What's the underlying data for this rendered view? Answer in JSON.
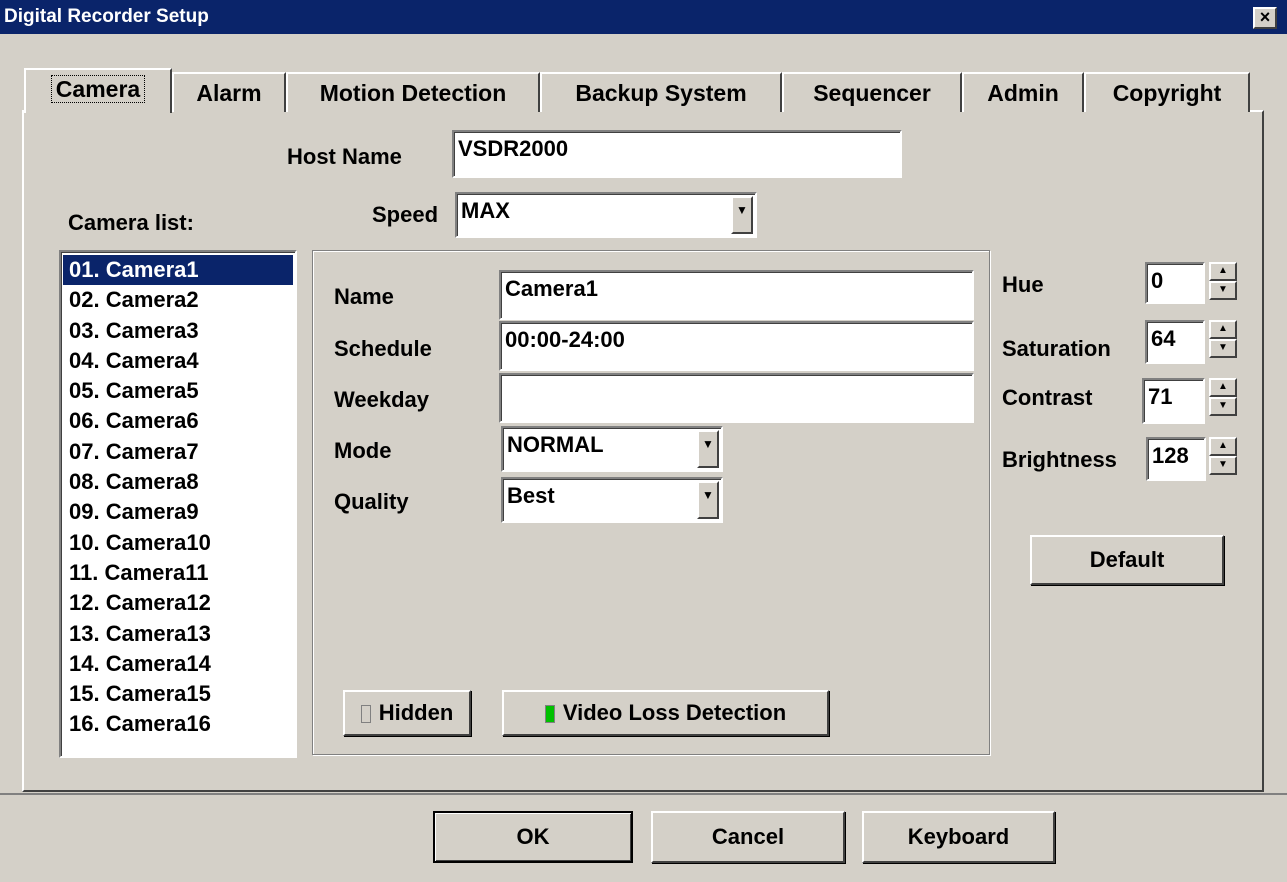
{
  "window": {
    "title": "Digital Recorder Setup",
    "close_label": "×"
  },
  "tabs": [
    {
      "label": "Camera",
      "active": true
    },
    {
      "label": "Alarm"
    },
    {
      "label": "Motion Detection"
    },
    {
      "label": "Backup System"
    },
    {
      "label": "Sequencer"
    },
    {
      "label": "Admin"
    },
    {
      "label": "Copyright"
    }
  ],
  "host": {
    "label": "Host Name",
    "value": "VSDR2000"
  },
  "speed": {
    "label": "Speed",
    "value": "MAX"
  },
  "camera_list": {
    "label": "Camera list:",
    "items": [
      "01. Camera1",
      "02. Camera2",
      "03. Camera3",
      "04. Camera4",
      "05. Camera5",
      "06. Camera6",
      "07. Camera7",
      "08. Camera8",
      "09. Camera9",
      "10. Camera10",
      "11. Camera11",
      "12. Camera12",
      "13. Camera13",
      "14. Camera14",
      "15. Camera15",
      "16. Camera16"
    ],
    "selected_index": 0
  },
  "details": {
    "name": {
      "label": "Name",
      "value": "Camera1"
    },
    "schedule": {
      "label": "Schedule",
      "value": "00:00-24:00"
    },
    "weekday": {
      "label": "Weekday",
      "value": ""
    },
    "mode": {
      "label": "Mode",
      "value": "NORMAL"
    },
    "quality": {
      "label": "Quality",
      "value": "Best"
    },
    "hidden_label": "Hidden",
    "hidden_on": false,
    "video_loss_label": "Video Loss Detection",
    "video_loss_on": true,
    "led_on_color": "#00c000",
    "led_off_color": "#d4d0c8"
  },
  "adjust": {
    "hue": {
      "label": "Hue",
      "value": "0"
    },
    "saturation": {
      "label": "Saturation",
      "value": "64"
    },
    "contrast": {
      "label": "Contrast",
      "value": "71"
    },
    "brightness": {
      "label": "Brightness",
      "value": "128"
    },
    "default_label": "Default"
  },
  "footer": {
    "ok_label": "OK",
    "cancel_label": "Cancel",
    "keyboard_label": "Keyboard"
  },
  "icons": {
    "up": "▲",
    "down": "▼"
  }
}
